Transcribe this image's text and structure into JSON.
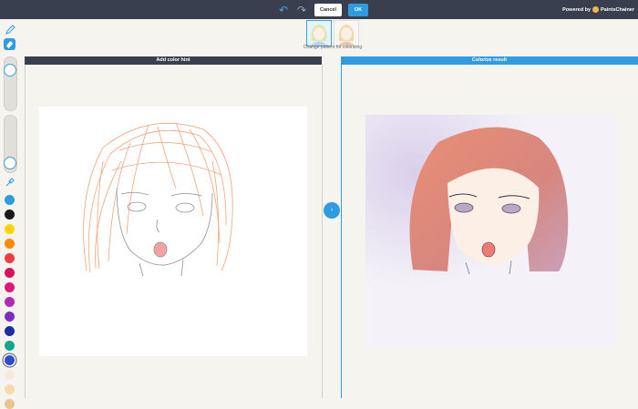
{
  "toolbar": {
    "cancel_label": "Cancel",
    "ok_label": "OK",
    "powered_by": "Powered by",
    "brand": "PaintsChainer"
  },
  "patterns": {
    "caption": "Change pattern for colorizing",
    "selected_index": 0
  },
  "panels": {
    "left_title": "Add color hint",
    "right_title": "Colorize result"
  },
  "tools": {
    "size_slider_level": 0.85,
    "opacity_slider_level": 0.1
  },
  "palette": [
    "#2f9be0",
    "#1a1a1a",
    "#ffd400",
    "#ff8a00",
    "#f03c3c",
    "#d8145c",
    "#e0187a",
    "#b22ab8",
    "#7b2fbf",
    "#1d2ea0",
    "#0fa88f",
    "#2e4cd1",
    "#f4e9df",
    "#f6d9ad",
    "#ebc38f"
  ],
  "colors": {
    "topbar": "#3a3f4f",
    "accent": "#2f9be0",
    "left_header": "#3a3f4f",
    "right_header": "#2f9be0"
  }
}
